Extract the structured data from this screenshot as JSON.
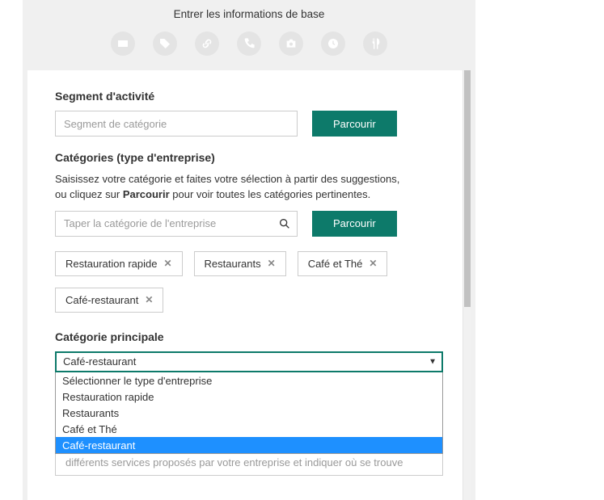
{
  "colors": {
    "accent": "#0d7a6a",
    "highlight": "#1e90ff"
  },
  "header": {
    "title": "Entrer les informations de base",
    "step_icons": [
      "card-icon",
      "tag-icon",
      "link-icon",
      "phone-icon",
      "camera-icon",
      "clock-icon",
      "cutlery-icon"
    ]
  },
  "segment": {
    "heading": "Segment d'activité",
    "placeholder": "Segment de catégorie",
    "browse": "Parcourir"
  },
  "categories": {
    "heading": "Catégories (type d'entreprise)",
    "help_pre": "Saisissez votre catégorie et faites votre sélection à partir des suggestions, ou cliquez sur ",
    "help_bold": "Parcourir",
    "help_post": " pour voir toutes les catégories pertinentes.",
    "placeholder": "Taper la catégorie de l'entreprise",
    "browse": "Parcourir",
    "chips": [
      "Restauration rapide",
      "Restaurants",
      "Café et Thé",
      "Café-restaurant"
    ]
  },
  "main_category": {
    "heading": "Catégorie principale",
    "selected": "Café-restaurant",
    "options": [
      "Sélectionner le type d'entreprise",
      "Restauration rapide",
      "Restaurants",
      "Café et Thé",
      "Café-restaurant"
    ],
    "highlighted_index": 4,
    "trailing_text": "différents services proposés par votre entreprise et indiquer où se trouve"
  }
}
